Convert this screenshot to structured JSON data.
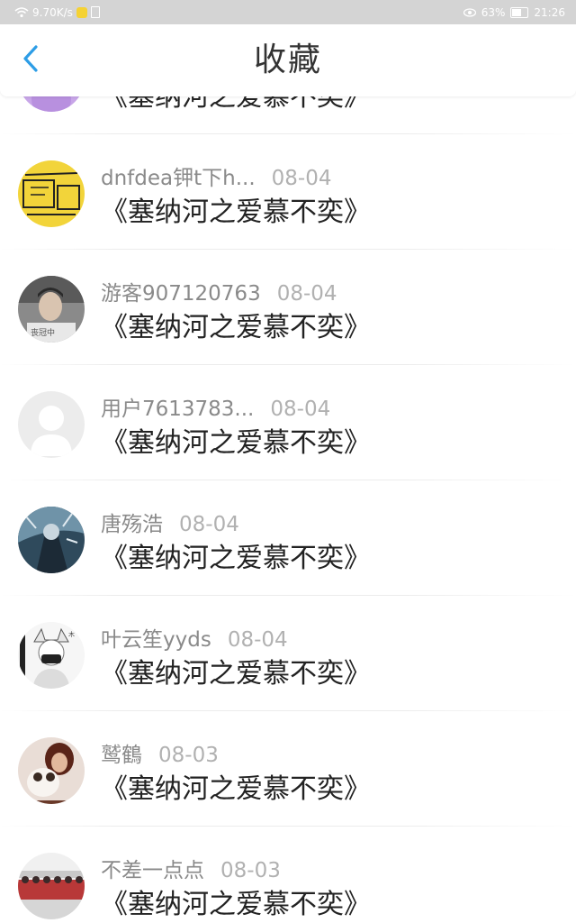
{
  "status_bar": {
    "speed": "9.70K/s",
    "battery": "63%",
    "time": "21:26",
    "icons": [
      "wifi-icon",
      "message-icon",
      "sim-icon",
      "eye-icon",
      "battery-icon"
    ]
  },
  "header": {
    "title": "收藏",
    "back_icon": "chevron-left-icon",
    "accent_color": "#2d9de6"
  },
  "list": {
    "items": [
      {
        "username": "",
        "date": "",
        "title": "《塞纳河之爱慕不奕》",
        "avatar": "purple-avatar"
      },
      {
        "username": "dnfdea钾t下h...",
        "date": "08-04",
        "title": "《塞纳河之爱慕不奕》",
        "avatar": "yellow-sketch-avatar"
      },
      {
        "username": "游客907120763",
        "date": "08-04",
        "title": "《塞纳河之爱慕不奕》",
        "avatar": "photo-avatar"
      },
      {
        "username": "用户7613783...",
        "date": "08-04",
        "title": "《塞纳河之爱慕不奕》",
        "avatar": "default-user-avatar"
      },
      {
        "username": "唐殇浩",
        "date": "08-04",
        "title": "《塞纳河之爱慕不奕》",
        "avatar": "anime-blue-avatar"
      },
      {
        "username": "叶云笙yyds",
        "date": "08-04",
        "title": "《塞纳河之爱慕不奕》",
        "avatar": "anime-white-avatar"
      },
      {
        "username": "鹫鶴",
        "date": "08-03",
        "title": "《塞纳河之爱慕不奕》",
        "avatar": "dog-photo-avatar"
      },
      {
        "username": "不差一点点",
        "date": "08-03",
        "title": "《塞纳河之爱慕不奕》",
        "avatar": "group-photo-avatar"
      }
    ]
  }
}
